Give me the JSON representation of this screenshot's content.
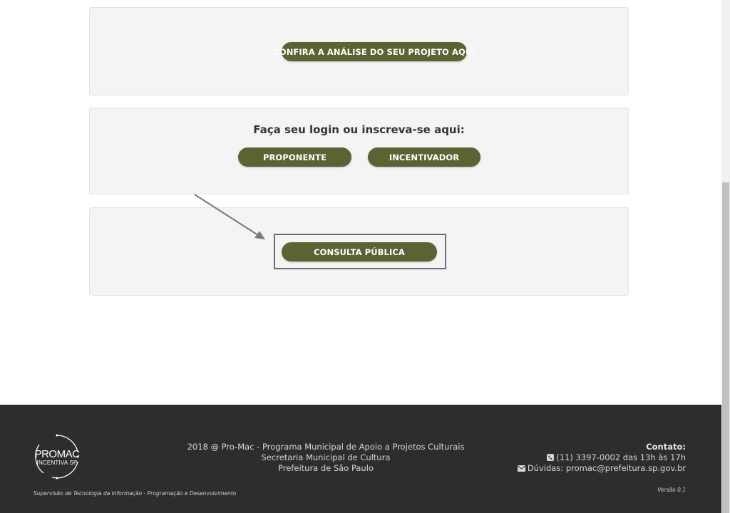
{
  "main": {
    "analise_button": "CONFIRA A ANÁLISE DO SEU PROJETO AQUI",
    "login_heading": "Faça seu login ou inscreva-se aqui:",
    "proponente_button": "PROPONENTE",
    "incentivador_button": "INCENTIVADOR",
    "consulta_button": "CONSULTA PÚBLICA"
  },
  "footer": {
    "logo_title": "PROMAC",
    "logo_subtitle": "INCENTIVA SP",
    "center_lines": [
      "2018 @ Pro-Mac - Programa Municipal de Apoio a Projetos Culturais",
      "Secretaria Municipal de Cultura",
      "Prefeitura de São Paulo"
    ],
    "contact_title": "Contato:",
    "phone": "(11) 3397-0002 das 13h às 17h",
    "email": "Dúvidas: promac@prefeitura.sp.gov.br",
    "supervisao": "Supervisão de Tecnologia da Informação - Programação e Desenvolvimento",
    "versao": "Versão 0.1"
  },
  "colors": {
    "button_bg": "#5a6332",
    "card_bg": "#f4f4f4",
    "footer_bg": "#2d2d2d"
  },
  "icons": [
    "phone-icon",
    "envelope-icon",
    "arrow-annotation"
  ]
}
